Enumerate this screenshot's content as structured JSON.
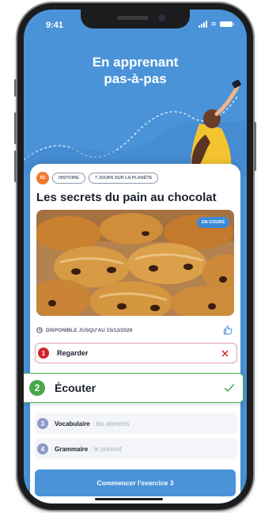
{
  "status": {
    "time": "9:41"
  },
  "hero": {
    "title_line1": "En apprenant",
    "title_line2": "pas-à-pas"
  },
  "lesson": {
    "number": "01",
    "tags": [
      "HISTOIRE",
      "7 JOURS SUR LA PLANÈTE"
    ],
    "title": "Les secrets du pain au chocolat",
    "badge": "EN COURS",
    "availability": "DISPONIBLE JUSQU'AU 15/12/2029"
  },
  "steps": [
    {
      "num": "1",
      "label": "Regarder",
      "sub": "",
      "state": "failed"
    },
    {
      "num": "2",
      "label": "Écouter",
      "sub": "",
      "state": "done"
    },
    {
      "num": "3",
      "label": "Vocabulaire",
      "sub": ": les aliments",
      "state": "pending"
    },
    {
      "num": "4",
      "label": "Grammaire",
      "sub": ": le présent",
      "state": "pending"
    }
  ],
  "cta": {
    "label": "Commencer l'exercice 3"
  },
  "colors": {
    "primary_blue": "#4a93d8",
    "error_red": "#d0242c",
    "success_green": "#46a84a",
    "pending_indigo": "#8f9ac6",
    "number_orange": "#f07a2b"
  },
  "icons": [
    "clock-icon",
    "thumbs-up-icon",
    "close-icon",
    "check-icon",
    "signal-icon",
    "wifi-icon",
    "battery-icon"
  ]
}
